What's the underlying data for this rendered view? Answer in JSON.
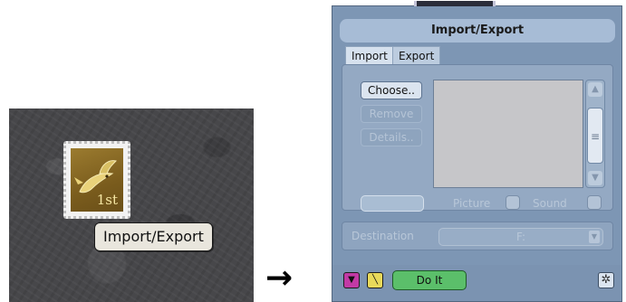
{
  "desktop": {
    "icon_label": "Import/Export",
    "stamp_text": "1st",
    "icon_name": "fish-stamp-icon"
  },
  "dialog": {
    "title": "Import/Export",
    "tabs": [
      {
        "label": "Import",
        "active": true
      },
      {
        "label": "Export",
        "active": false
      }
    ],
    "buttons": {
      "choose": "Choose..",
      "remove": "Remove",
      "details": "Details.."
    },
    "options": {
      "picture_label": "Picture",
      "sound_label": "Sound"
    },
    "destination": {
      "label": "Destination",
      "value": "F:"
    },
    "footer": {
      "do_it": "Do It",
      "menu_icon": "triangle-down-icon",
      "tool_icon": "wand-icon",
      "star_icon": "asterisk-icon",
      "star_glyph": "✲"
    },
    "colors": {
      "window_bg": "#7d96b4",
      "do_it_green": "#5bbf6a",
      "menu_magenta": "#c23aa5",
      "tool_yellow": "#e8d95a"
    }
  },
  "arrow": "→"
}
